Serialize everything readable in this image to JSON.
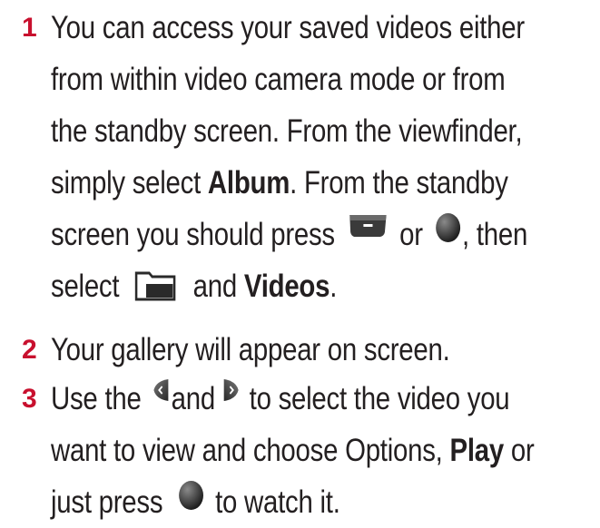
{
  "steps": [
    {
      "number": "1",
      "lines": [
        "You can access your saved videos either",
        "from within video camera mode or from",
        "the standby screen. From the viewfinder,"
      ],
      "l4_pre": "simply select ",
      "l4_bold": "Album",
      "l4_post": ". From the standby",
      "l5_pre": "screen you should press ",
      "l5_mid": " or ",
      "l5_post": ", then",
      "l6_pre": "select ",
      "l6_mid": " and ",
      "l6_bold": "Videos",
      "l6_post": "."
    },
    {
      "number": "2",
      "lines": [
        "Your gallery will appear on screen."
      ]
    },
    {
      "number": "3",
      "l1_pre": "Use the ",
      "l1_mid": "and ",
      "l1_post": " to select the video you",
      "l2_pre": "want to view and choose Options, ",
      "l2_bold": "Play",
      "l2_post": " or",
      "l3_pre": "just press ",
      "l3_post": " to watch it."
    }
  ],
  "icons": {
    "soft_key": "left-soft-key-icon",
    "ok_key": "ok-button-icon",
    "folder": "folder-icon",
    "left": "nav-left-icon",
    "right": "nav-right-icon"
  }
}
